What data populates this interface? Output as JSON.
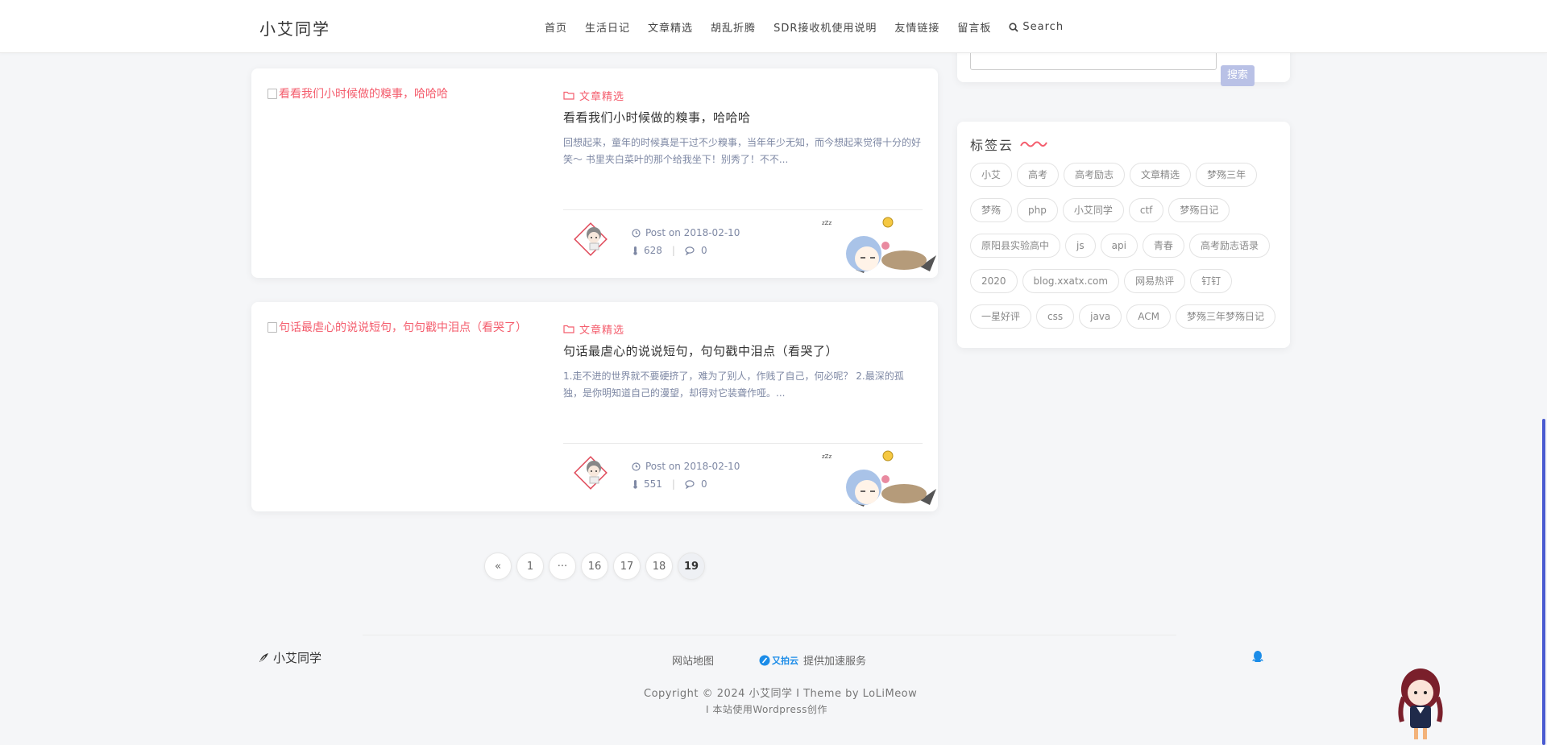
{
  "header": {
    "brand": "小艾同学",
    "nav": [
      "首页",
      "生活日记",
      "文章精选",
      "胡乱折腾",
      "SDR接收机使用说明",
      "友情链接",
      "留言板"
    ],
    "search_label": "Search"
  },
  "search_widget": {
    "button_label": "搜索"
  },
  "tag_cloud": {
    "title": "标签云",
    "tags": [
      "小艾",
      "高考",
      "高考励志",
      "文章精选",
      "梦殇三年",
      "梦殇",
      "php",
      "小艾同学",
      "ctf",
      "梦殇日记",
      "原阳县实验高中",
      "js",
      "api",
      "青春",
      "高考励志语录",
      "2020",
      "blog.xxatx.com",
      "网易热评",
      "钉钉",
      "一星好评",
      "css",
      "java",
      "ACM",
      "梦殇三年梦殇日记"
    ]
  },
  "posts": [
    {
      "thumb_alt": "看看我们小时候做的糗事，哈哈哈",
      "category": "文章精选",
      "title": "看看我们小时候做的糗事，哈哈哈",
      "excerpt": "回想起来，童年的时候真是干过不少糗事，当年年少无知，而今想起来觉得十分的好笑～ 书里夹白菜叶的那个给我坐下！别秀了！不不...",
      "date": "Post on 2018-02-10",
      "views": "628",
      "comments": "0"
    },
    {
      "thumb_alt": "句话最虐心的说说短句，句句戳中泪点（看哭了）",
      "category": "文章精选",
      "title": "句话最虐心的说说短句，句句戳中泪点（看哭了）",
      "excerpt": "1.走不进的世界就不要硬挤了，难为了别人，作贱了自己，何必呢？ 2.最深的孤独，是你明知道自己的漫望，却得对它装聋作哑。...",
      "date": "Post on 2018-02-10",
      "views": "551",
      "comments": "0"
    }
  ],
  "pagination": {
    "prev": "«",
    "pages": [
      "1",
      "···",
      "16",
      "17",
      "18",
      "19"
    ],
    "current": "19"
  },
  "footer": {
    "brand": "小艾同学",
    "sitemap": "网站地图",
    "sponsor_logo": "又拍云",
    "sponsor_text": "提供加速服务",
    "copyright": "Copyright © 2024 小艾同学 I Theme by LoLiMeow",
    "powered": "I 本站使用Wordpress创作"
  },
  "colors": {
    "accent": "#f45d6d",
    "muted": "#7e88a4",
    "button": "#b9c1e6"
  }
}
